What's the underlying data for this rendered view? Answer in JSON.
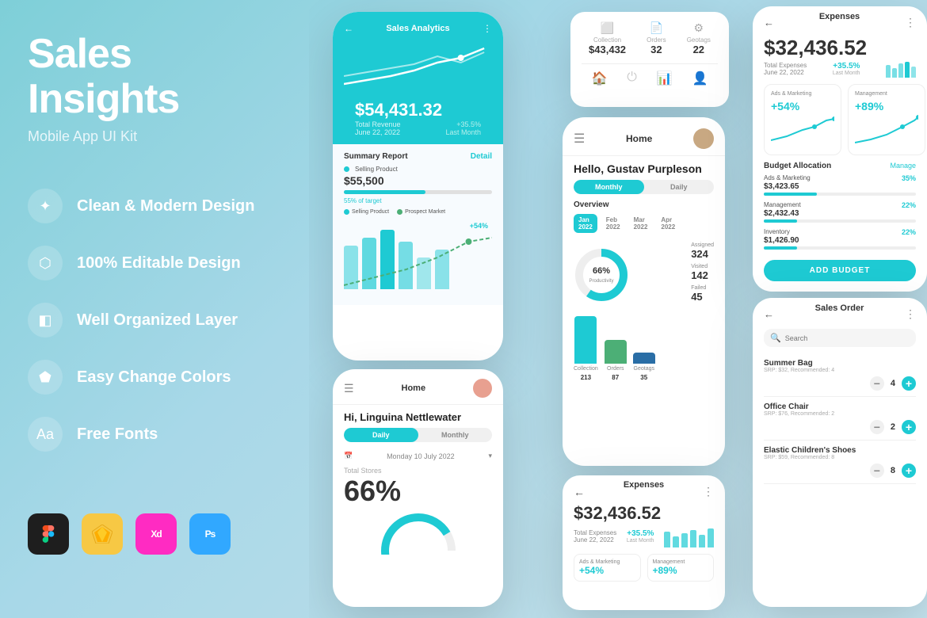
{
  "left": {
    "title_line1": "Sales Insights",
    "subtitle": "Mobile App UI Kit",
    "features": [
      {
        "icon": "✦",
        "label": "Clean & Modern Design"
      },
      {
        "icon": "⬡",
        "label": "100% Editable Design"
      },
      {
        "icon": "◧",
        "label": "Well Organized Layer"
      },
      {
        "icon": "⬟",
        "label": "Easy Change Colors"
      },
      {
        "icon": "Aa",
        "label": "Free Fonts"
      }
    ],
    "tools": [
      {
        "name": "figma",
        "label": "F"
      },
      {
        "name": "sketch",
        "label": "S"
      },
      {
        "name": "xd",
        "label": "Xd"
      },
      {
        "name": "ps",
        "label": "Ps"
      }
    ]
  },
  "phone_analytics": {
    "title": "Sales Analytics",
    "amount": "$54,431.32",
    "label": "Total Revenue",
    "date": "June 22, 2022",
    "change": "+35.5%",
    "change_label": "Last Month",
    "summary_title": "Summary Report",
    "summary_detail": "Detail",
    "selling_label": "Selling Product",
    "selling_amount": "$55,500",
    "progress_text": "55% of target",
    "prospect_label": "Prospect Market",
    "chart_increase": "+54%"
  },
  "phone_stats": {
    "collection_label": "Collection",
    "collection_val": "$43,432",
    "orders_label": "Orders",
    "orders_val": "32",
    "geotags_label": "Geotags",
    "geotags_val": "22"
  },
  "phone_home": {
    "title": "Home",
    "greeting": "Hello, Gustav Purpleson",
    "tab_monthly": "Monthly",
    "tab_daily": "Daily",
    "overview": "Overview",
    "months": [
      "Jan 2022",
      "Feb 2022",
      "Mar 2022",
      "Apr 2022"
    ],
    "productivity": "66%",
    "productivity_label": "Productivity",
    "assigned_label": "Assigned",
    "assigned_val": "324",
    "visited_label": "Visited",
    "visited_val": "142",
    "failed_label": "Failed",
    "failed_val": "45",
    "bars": [
      {
        "label": "Collection",
        "val": 213,
        "color": "#1ecad3"
      },
      {
        "label": "Orders",
        "val": 87,
        "color": "#4caf76"
      },
      {
        "label": "Geotags",
        "val": 35,
        "color": "#2a6ea6"
      }
    ]
  },
  "phone_home2": {
    "title": "Home",
    "greeting": "Hi, Linguina Nettlewater",
    "tab_daily": "Daily",
    "tab_monthly": "Monthly",
    "date": "Monday 10 July 2022",
    "total_stores": "Total Stores",
    "pct": "66%"
  },
  "phone_expenses_bottom": {
    "back": "←",
    "title": "Expenses",
    "amount": "$32,436.52",
    "label": "Total Expenses",
    "date": "June 22, 2022",
    "change": "+35.5%",
    "change_label": "Last Month"
  },
  "phone_right_expenses": {
    "back": "←",
    "title": "Expenses",
    "amount": "$32,436.52",
    "label": "Total Expenses",
    "date": "June 22, 2022",
    "change": "+35.5%",
    "change_label": "Last Month",
    "card1_label": "Ads & Marketing",
    "card1_val": "+54%",
    "card2_label": "Management",
    "card2_val": "+89%",
    "budget_title": "Budget Allocation",
    "budget_manage": "Manage",
    "budget_items": [
      {
        "name": "Ads & Marketing",
        "amount": "$3,423.65",
        "pct": "35%",
        "fill": 35
      },
      {
        "name": "Management",
        "amount": "$2,432.43",
        "pct": "22%",
        "fill": 22
      },
      {
        "name": "Inventory",
        "amount": "$1,426.90",
        "pct": "22%",
        "fill": 22
      }
    ],
    "add_budget_btn": "ADD BUDGET"
  },
  "phone_sales_order": {
    "back": "←",
    "title": "Sales Order",
    "search_placeholder": "Search",
    "items": [
      {
        "name": "Summer Bag",
        "sub": "SRP: $32, Recommended: 4",
        "qty": 4
      },
      {
        "name": "Office Chair",
        "sub": "SRP: $76, Recommended: 2",
        "qty": 2
      },
      {
        "name": "Elastic Children's Shoes",
        "sub": "SRP: $59, Recommended: 8",
        "qty": 8
      }
    ]
  }
}
